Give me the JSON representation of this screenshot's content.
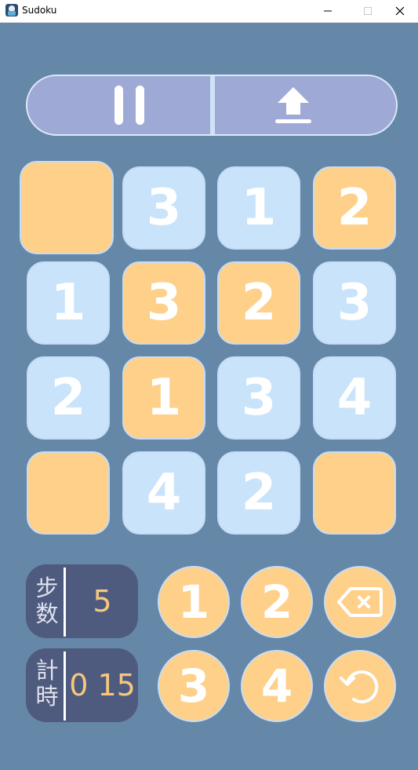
{
  "window": {
    "title": "Sudoku"
  },
  "controls": {
    "pause_icon": "pause-icon",
    "upload_icon": "upload-icon"
  },
  "grid": {
    "cells": [
      "",
      "3",
      "1",
      "2",
      "1",
      "3",
      "2",
      "3",
      "2",
      "1",
      "3",
      "4",
      "",
      "4",
      "2",
      ""
    ],
    "colors": [
      "orange",
      "blue",
      "blue",
      "orange",
      "blue",
      "orange",
      "orange",
      "blue",
      "blue",
      "orange",
      "blue",
      "blue",
      "orange",
      "blue",
      "blue",
      "orange"
    ]
  },
  "stats": {
    "steps_label": "步\n数",
    "steps_value": "5",
    "time_label": "計\n時",
    "time_value": "0 15"
  },
  "keypad": {
    "keys": [
      "1",
      "2",
      "3",
      "4"
    ],
    "backspace_icon": "backspace-icon",
    "undo_icon": "undo-icon"
  },
  "colors": {
    "background": "#6587a8",
    "tile_blue": "#c9e3fb",
    "tile_orange": "#fed08a",
    "stat_box": "#4f5b7e",
    "stat_value": "#f6c77c",
    "pill": "#9fa9d6"
  }
}
